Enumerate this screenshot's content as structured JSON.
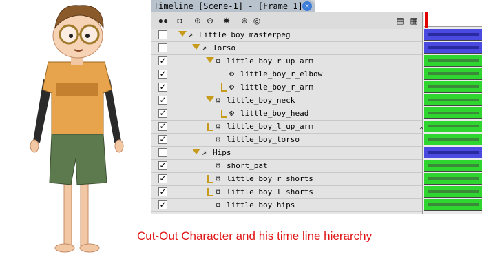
{
  "timeline": {
    "title": "Timeline [Scene-1] - [Frame 1]",
    "close_symbol": "×"
  },
  "toolbar_icons": [
    "onion-skin-icon",
    "frame-mode-icon",
    "add-layer-icon",
    "add-effect-icon",
    "add-peg-icon",
    "add-drawing-icon",
    "menu-icon",
    "layer-menu-icon"
  ],
  "layers": [
    {
      "name": "Little_boy_masterpeg",
      "checked": false,
      "type": "peg",
      "expanded": true,
      "level": 0
    },
    {
      "name": "Torso",
      "checked": false,
      "type": "peg",
      "expanded": true,
      "level": 1
    },
    {
      "name": "little_boy_r_up_arm",
      "checked": true,
      "type": "drawing",
      "expanded": true,
      "level": 2
    },
    {
      "name": "little_boy_r_elbow",
      "checked": true,
      "type": "drawing",
      "expanded": null,
      "level": 3
    },
    {
      "name": "little_boy_r_arm",
      "checked": true,
      "type": "drawing",
      "expanded": false,
      "level": 3
    },
    {
      "name": "little_boy_neck",
      "checked": true,
      "type": "drawing",
      "expanded": true,
      "level": 2
    },
    {
      "name": "little_boy_head",
      "checked": true,
      "type": "drawing",
      "expanded": false,
      "level": 3
    },
    {
      "name": "little_boy_l_up_arm",
      "checked": true,
      "type": "drawing",
      "expanded": false,
      "level": 2
    },
    {
      "name": "little_boy_torso",
      "checked": true,
      "type": "drawing",
      "expanded": null,
      "level": 2
    },
    {
      "name": "Hips",
      "checked": false,
      "type": "peg",
      "expanded": true,
      "level": 1
    },
    {
      "name": "short_pat",
      "checked": true,
      "type": "drawing",
      "expanded": null,
      "level": 2
    },
    {
      "name": "little_boy_r_shorts",
      "checked": true,
      "type": "drawing",
      "expanded": false,
      "level": 2
    },
    {
      "name": "little boy_l_shorts",
      "checked": true,
      "type": "drawing",
      "expanded": false,
      "level": 2
    },
    {
      "name": "little_boy_hips",
      "checked": true,
      "type": "drawing",
      "expanded": null,
      "level": 2
    }
  ],
  "cell_colors": {
    "peg": "#4a4ae0",
    "drawing": "#2fd62f",
    "bar": "#3a8a3a",
    "peg_bar": "#2a2aa0"
  },
  "caption": "Cut-Out Character and his time line hierarchy"
}
